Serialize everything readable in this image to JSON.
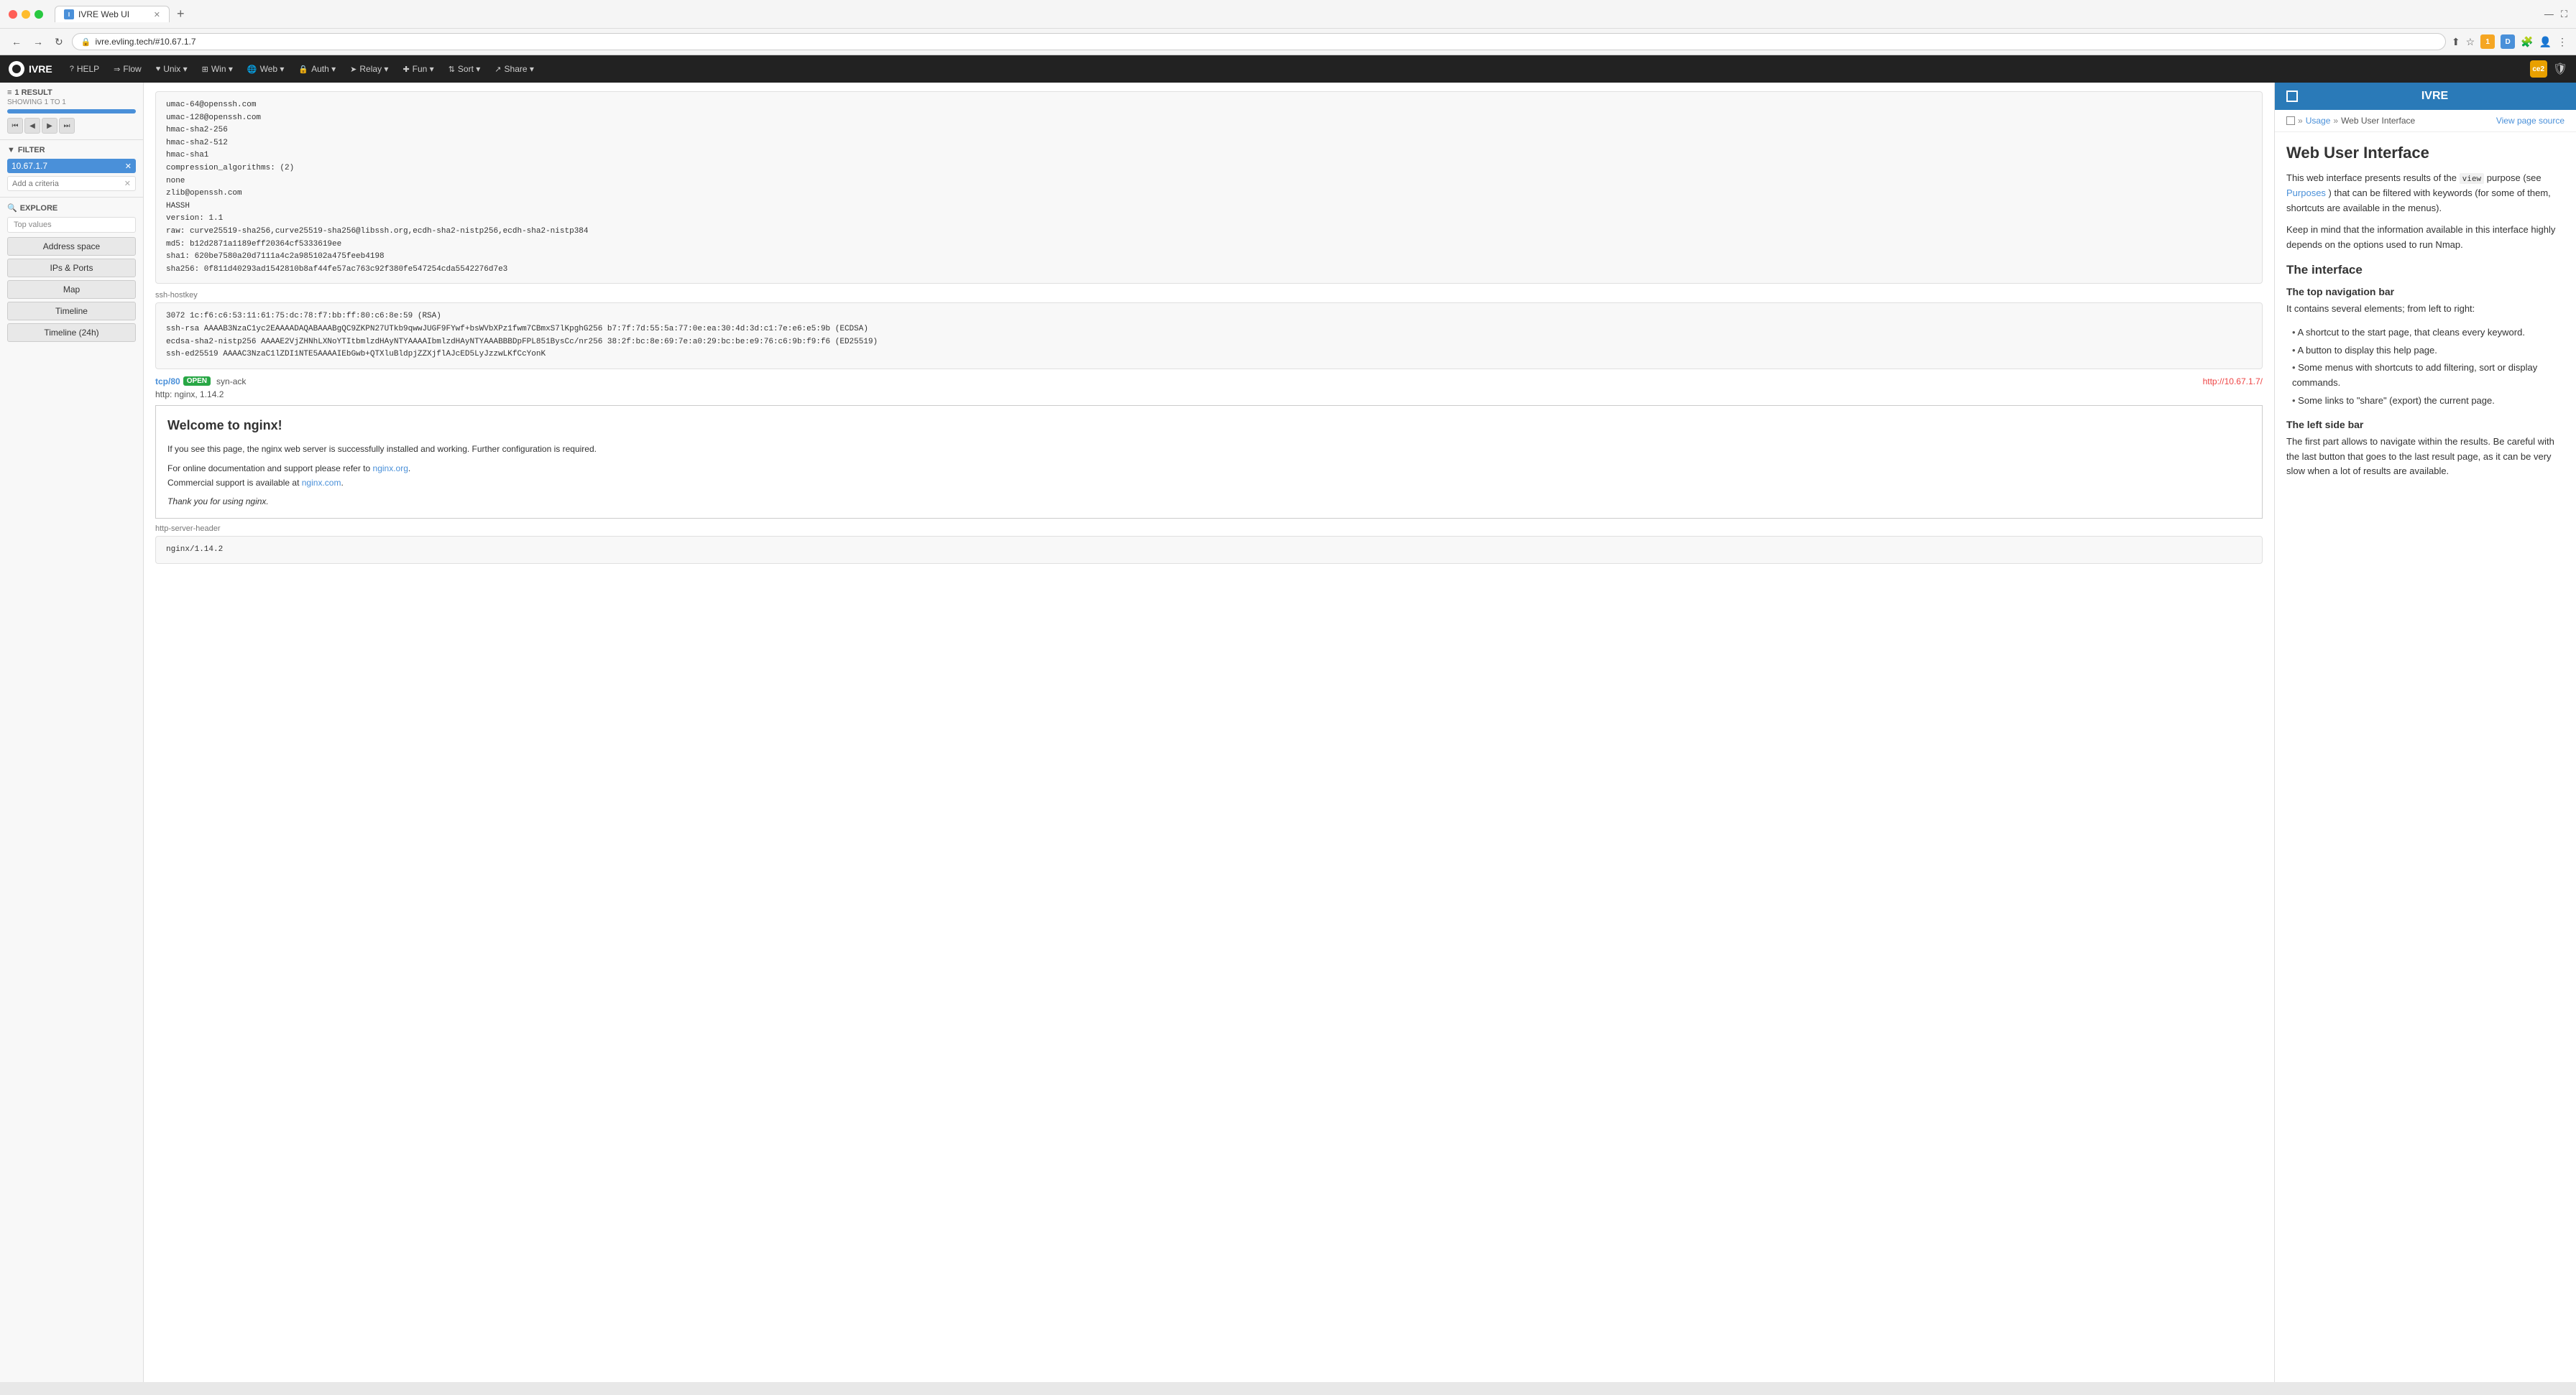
{
  "browser": {
    "tab_title": "IVRE Web UI",
    "tab_favicon": "I",
    "url": "ivre.evling.tech/#10.67.1.7",
    "new_tab": "+",
    "nav_back": "←",
    "nav_forward": "→",
    "nav_reload": "↻"
  },
  "topnav": {
    "brand_name": "IVRE",
    "items": [
      {
        "icon": "?",
        "label": "HELP"
      },
      {
        "icon": "→→",
        "label": "Flow"
      },
      {
        "icon": "♥",
        "label": "Unix ▾"
      },
      {
        "icon": "⊞",
        "label": "Win ▾"
      },
      {
        "icon": "🌐",
        "label": "Web ▾"
      },
      {
        "icon": "🔒",
        "label": "Auth ▾"
      },
      {
        "icon": "➤",
        "label": "Relay ▾"
      },
      {
        "icon": "✚",
        "label": "Fun ▾"
      },
      {
        "icon": "⇅",
        "label": "Sort ▾"
      },
      {
        "icon": "↗",
        "label": "Share ▾"
      }
    ],
    "avatar": "ce2",
    "shield": "🛡"
  },
  "sidebar": {
    "results_count": "1 RESULT",
    "results_showing": "SHOWING 1 TO 1",
    "filter_label": "FILTER",
    "filter_value": "10.67.1.7",
    "add_criteria_placeholder": "Add a criteria",
    "explore_label": "EXPLORE",
    "explore_search_placeholder": "Top values",
    "explore_buttons": [
      "Address space",
      "IPs & Ports",
      "Map",
      "Timeline",
      "Timeline (24h)"
    ]
  },
  "host": {
    "ssh_hostkey_label": "ssh-hostkey",
    "ssh_hostkey_code": "3072 1c:f6:c6:53:11:61:75:dc:78:f7:bb:ff:80:c6:8e:59 (RSA)\nssh-rsa AAAAB3NzaC1yc2EAAAADAQABAAABgQC9ZKPN27UTkb9qwwJUGF9FYwf+bsWVbXPz1fwm7CBmxS7lKpghG256 b7:7f:7d:55:5a:77:0e:ea:30:4d:3d:c1:7e:e6:e5:9b (ECDSA)\necdsa-sha2-nistp256 AAAAE2VjZHNhLXNoYTItbmlzdHAyNTYAAAAIbmlzdHAyNTYAAABBBDpFPL851BysCc/nr256 38:2f:bc:8e:69:7e:a0:29:bc:be:e9:76:c6:9b:f9:f6 (ED25519)\nssh-ed25519 AAAAC3NzaC1lZDI1NTE5AAAAIEbGwb+QTXluBldpjZZXjflAJcED5LyJzzwLKfCcYonK",
    "tcp80_port": "tcp/80",
    "tcp80_state": "OPEN",
    "tcp80_protocol": "syn-ack",
    "tcp80_url": "http://10.67.1.7/",
    "tcp80_service": "http: nginx, 1.14.2",
    "nginx_title": "Welcome to nginx!",
    "nginx_body": "If you see this page, the nginx web server is successfully installed and working. Further configuration is required.",
    "nginx_doc": "For online documentation and support please refer to ",
    "nginx_doc_link": "nginx.org",
    "nginx_commercial": "Commercial support is available at ",
    "nginx_commercial_link": "nginx.com",
    "nginx_thanks": "Thank you for using nginx.",
    "http_server_header_label": "http-server-header",
    "http_server_header_value": "nginx/1.14.2",
    "ssh_algorithms_code": "umac-64@openssh.com\numac-128@openssh.com\nhmac-sha2-256\nhmac-sha2-512\nhmac-sha1\ncompression_algorithms: (2)\nnone\nzlib@openssh.com\nHASSH\nversion: 1.1\nraw: curve25519-sha256,curve25519-sha256@libssh.org,ecdh-sha2-nistp256,ecdh-sha2-nistp384\nmd5: b12d2871a1189eff20364cf5333619ee\nsha1: 620be7580a20d7111a4c2a985102a475feeb4198\nsha256: 0f811d40293ad1542810b8af44fe57ac763c92f380fe547254cda5542276d7e3"
  },
  "help": {
    "title": "IVRE",
    "breadcrumb_home": "□",
    "breadcrumb_usage": "Usage",
    "breadcrumb_current": "Web User Interface",
    "view_source": "View page source",
    "h1": "Web User Interface",
    "intro1": "This web interface presents results of the",
    "intro_code": "view",
    "intro2": "purpose (see",
    "intro_link": "Purposes",
    "intro3": ") that can be filtered with keywords (for some of them, shortcuts are available in the menus).",
    "para2": "Keep in mind that the information available in this interface highly depends on the options used to run Nmap.",
    "h2_interface": "The interface",
    "h3_topnav": "The top navigation bar",
    "topnav_intro": "It contains several elements; from left to right:",
    "topnav_items": [
      "A shortcut to the start page, that cleans every keyword.",
      "A button to display this help page.",
      "Some menus with shortcuts to add filtering, sort or display commands.",
      "Some links to \"share\" (export) the current page."
    ],
    "h3_sidebar": "The left side bar",
    "sidebar_desc": "The first part allows to navigate within the results. Be careful with the last button that goes to the last result page, as it can be very slow when a lot of results are available."
  }
}
